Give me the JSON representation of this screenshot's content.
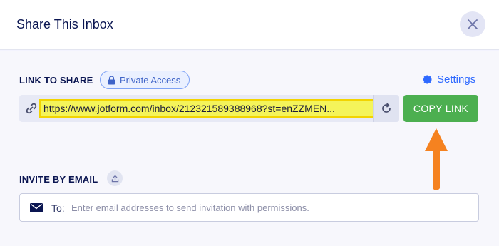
{
  "dialog": {
    "title": "Share This Inbox"
  },
  "link_section": {
    "label": "LINK TO SHARE",
    "badge_label": "Private Access",
    "settings_label": "Settings",
    "url": "https://www.jotform.com/inbox/212321589388968?st=enZZMEN...",
    "copy_label": "COPY LINK"
  },
  "invite_section": {
    "label": "INVITE BY EMAIL",
    "to_label": "To:",
    "placeholder": "Enter email addresses to send invitation with permissions."
  },
  "icons": [
    "close-icon",
    "lock-icon",
    "gear-icon",
    "link-icon",
    "refresh-icon",
    "upload-icon",
    "mail-icon",
    "arrow-up-icon"
  ],
  "colors": {
    "copy_button": "#4caf50",
    "url_highlight": "#f4f45a",
    "arrow": "#f58220",
    "accent": "#2e69ff"
  }
}
